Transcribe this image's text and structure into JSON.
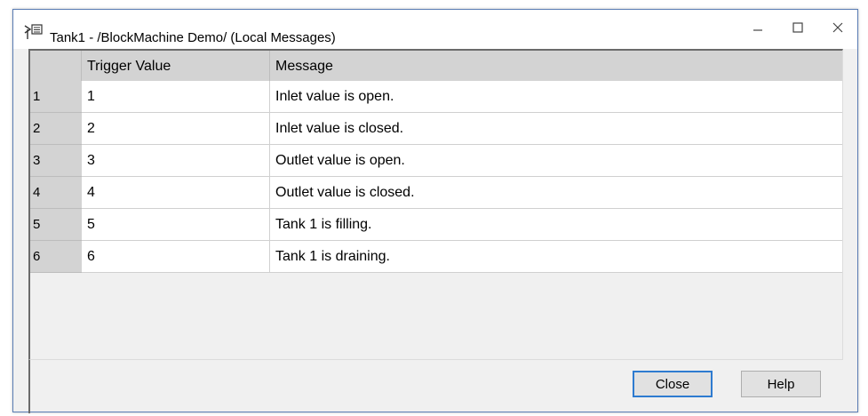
{
  "window": {
    "title": "Tank1 - /BlockMachine Demo/ (Local Messages)"
  },
  "titlebar_buttons": {
    "minimize": "minimize-icon",
    "maximize": "maximize-icon",
    "close": "close-icon"
  },
  "table": {
    "columns": [
      "",
      "Trigger Value",
      "Message"
    ],
    "rows": [
      {
        "index": "1",
        "trigger": "1",
        "message": "Inlet value is open."
      },
      {
        "index": "2",
        "trigger": "2",
        "message": "Inlet value is closed."
      },
      {
        "index": "3",
        "trigger": "3",
        "message": "Outlet value is open."
      },
      {
        "index": "4",
        "trigger": "4",
        "message": "Outlet value is closed."
      },
      {
        "index": "5",
        "trigger": "5",
        "message": "Tank 1 is filling."
      },
      {
        "index": "6",
        "trigger": "6",
        "message": "Tank 1 is draining."
      }
    ]
  },
  "buttons": {
    "close": "Close",
    "help": "Help"
  },
  "colors": {
    "accent": "#2e7bd0",
    "header_bg": "#d3d3d3",
    "window_bg": "#f0f0f0"
  }
}
